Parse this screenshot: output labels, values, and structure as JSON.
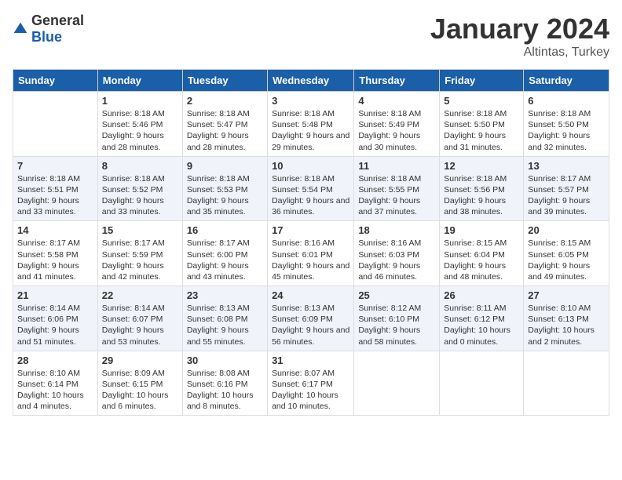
{
  "logo": {
    "general": "General",
    "blue": "Blue"
  },
  "title": "January 2024",
  "location": "Altintas, Turkey",
  "headers": [
    "Sunday",
    "Monday",
    "Tuesday",
    "Wednesday",
    "Thursday",
    "Friday",
    "Saturday"
  ],
  "weeks": [
    [
      {
        "day": "",
        "empty": true
      },
      {
        "day": "1",
        "sunrise": "8:18 AM",
        "sunset": "5:46 PM",
        "daylight": "9 hours and 28 minutes."
      },
      {
        "day": "2",
        "sunrise": "8:18 AM",
        "sunset": "5:47 PM",
        "daylight": "9 hours and 28 minutes."
      },
      {
        "day": "3",
        "sunrise": "8:18 AM",
        "sunset": "5:48 PM",
        "daylight": "9 hours and 29 minutes."
      },
      {
        "day": "4",
        "sunrise": "8:18 AM",
        "sunset": "5:49 PM",
        "daylight": "9 hours and 30 minutes."
      },
      {
        "day": "5",
        "sunrise": "8:18 AM",
        "sunset": "5:50 PM",
        "daylight": "9 hours and 31 minutes."
      },
      {
        "day": "6",
        "sunrise": "8:18 AM",
        "sunset": "5:50 PM",
        "daylight": "9 hours and 32 minutes."
      }
    ],
    [
      {
        "day": "7",
        "sunrise": "8:18 AM",
        "sunset": "5:51 PM",
        "daylight": "9 hours and 33 minutes."
      },
      {
        "day": "8",
        "sunrise": "8:18 AM",
        "sunset": "5:52 PM",
        "daylight": "9 hours and 33 minutes."
      },
      {
        "day": "9",
        "sunrise": "8:18 AM",
        "sunset": "5:53 PM",
        "daylight": "9 hours and 35 minutes."
      },
      {
        "day": "10",
        "sunrise": "8:18 AM",
        "sunset": "5:54 PM",
        "daylight": "9 hours and 36 minutes."
      },
      {
        "day": "11",
        "sunrise": "8:18 AM",
        "sunset": "5:55 PM",
        "daylight": "9 hours and 37 minutes."
      },
      {
        "day": "12",
        "sunrise": "8:18 AM",
        "sunset": "5:56 PM",
        "daylight": "9 hours and 38 minutes."
      },
      {
        "day": "13",
        "sunrise": "8:17 AM",
        "sunset": "5:57 PM",
        "daylight": "9 hours and 39 minutes."
      }
    ],
    [
      {
        "day": "14",
        "sunrise": "8:17 AM",
        "sunset": "5:58 PM",
        "daylight": "9 hours and 41 minutes."
      },
      {
        "day": "15",
        "sunrise": "8:17 AM",
        "sunset": "5:59 PM",
        "daylight": "9 hours and 42 minutes."
      },
      {
        "day": "16",
        "sunrise": "8:17 AM",
        "sunset": "6:00 PM",
        "daylight": "9 hours and 43 minutes."
      },
      {
        "day": "17",
        "sunrise": "8:16 AM",
        "sunset": "6:01 PM",
        "daylight": "9 hours and 45 minutes."
      },
      {
        "day": "18",
        "sunrise": "8:16 AM",
        "sunset": "6:03 PM",
        "daylight": "9 hours and 46 minutes."
      },
      {
        "day": "19",
        "sunrise": "8:15 AM",
        "sunset": "6:04 PM",
        "daylight": "9 hours and 48 minutes."
      },
      {
        "day": "20",
        "sunrise": "8:15 AM",
        "sunset": "6:05 PM",
        "daylight": "9 hours and 49 minutes."
      }
    ],
    [
      {
        "day": "21",
        "sunrise": "8:14 AM",
        "sunset": "6:06 PM",
        "daylight": "9 hours and 51 minutes."
      },
      {
        "day": "22",
        "sunrise": "8:14 AM",
        "sunset": "6:07 PM",
        "daylight": "9 hours and 53 minutes."
      },
      {
        "day": "23",
        "sunrise": "8:13 AM",
        "sunset": "6:08 PM",
        "daylight": "9 hours and 55 minutes."
      },
      {
        "day": "24",
        "sunrise": "8:13 AM",
        "sunset": "6:09 PM",
        "daylight": "9 hours and 56 minutes."
      },
      {
        "day": "25",
        "sunrise": "8:12 AM",
        "sunset": "6:10 PM",
        "daylight": "9 hours and 58 minutes."
      },
      {
        "day": "26",
        "sunrise": "8:11 AM",
        "sunset": "6:12 PM",
        "daylight": "10 hours and 0 minutes."
      },
      {
        "day": "27",
        "sunrise": "8:10 AM",
        "sunset": "6:13 PM",
        "daylight": "10 hours and 2 minutes."
      }
    ],
    [
      {
        "day": "28",
        "sunrise": "8:10 AM",
        "sunset": "6:14 PM",
        "daylight": "10 hours and 4 minutes."
      },
      {
        "day": "29",
        "sunrise": "8:09 AM",
        "sunset": "6:15 PM",
        "daylight": "10 hours and 6 minutes."
      },
      {
        "day": "30",
        "sunrise": "8:08 AM",
        "sunset": "6:16 PM",
        "daylight": "10 hours and 8 minutes."
      },
      {
        "day": "31",
        "sunrise": "8:07 AM",
        "sunset": "6:17 PM",
        "daylight": "10 hours and 10 minutes."
      },
      {
        "day": "",
        "empty": true
      },
      {
        "day": "",
        "empty": true
      },
      {
        "day": "",
        "empty": true
      }
    ]
  ],
  "labels": {
    "sunrise": "Sunrise:",
    "sunset": "Sunset:",
    "daylight": "Daylight:"
  }
}
